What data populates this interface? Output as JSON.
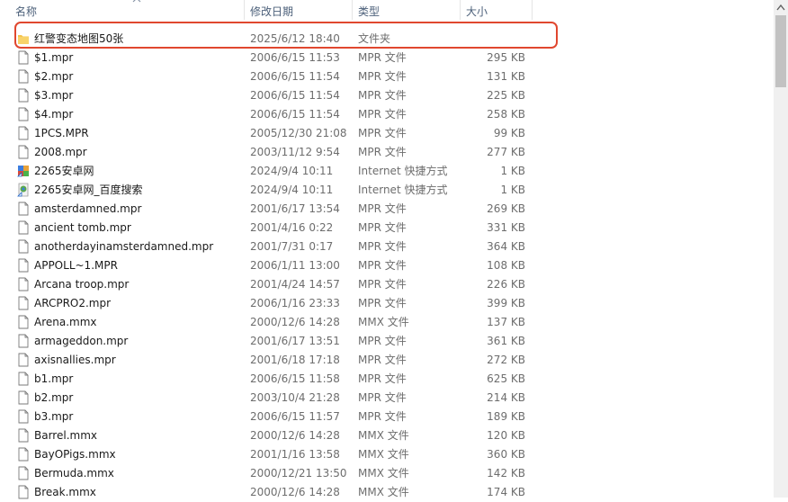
{
  "columns": {
    "name": "名称",
    "modified": "修改日期",
    "type": "类型",
    "size": "大小"
  },
  "rows": [
    {
      "icon": "folder",
      "name": "红警变态地图50张",
      "date": "2025/6/12 18:40",
      "type": "文件夹",
      "size": ""
    },
    {
      "icon": "file",
      "name": "$1.mpr",
      "date": "2006/6/15 11:53",
      "type": "MPR 文件",
      "size": "295 KB"
    },
    {
      "icon": "file",
      "name": "$2.mpr",
      "date": "2006/6/15 11:54",
      "type": "MPR 文件",
      "size": "131 KB"
    },
    {
      "icon": "file",
      "name": "$3.mpr",
      "date": "2006/6/15 11:54",
      "type": "MPR 文件",
      "size": "225 KB"
    },
    {
      "icon": "file",
      "name": "$4.mpr",
      "date": "2006/6/15 11:54",
      "type": "MPR 文件",
      "size": "258 KB"
    },
    {
      "icon": "file",
      "name": "1PCS.MPR",
      "date": "2005/12/30 21:08",
      "type": "MPR 文件",
      "size": "99 KB"
    },
    {
      "icon": "file",
      "name": "2008.mpr",
      "date": "2003/11/12 9:54",
      "type": "MPR 文件",
      "size": "277 KB"
    },
    {
      "icon": "internet-shortcut",
      "name": "2265安卓网",
      "date": "2024/9/4 10:11",
      "type": "Internet 快捷方式",
      "size": "1 KB"
    },
    {
      "icon": "internet-shortcut-2",
      "name": "2265安卓网_百度搜索",
      "date": "2024/9/4 10:11",
      "type": "Internet 快捷方式",
      "size": "1 KB"
    },
    {
      "icon": "file",
      "name": "amsterdamned.mpr",
      "date": "2001/6/17 13:54",
      "type": "MPR 文件",
      "size": "269 KB"
    },
    {
      "icon": "file",
      "name": "ancient tomb.mpr",
      "date": "2001/4/16 0:22",
      "type": "MPR 文件",
      "size": "331 KB"
    },
    {
      "icon": "file",
      "name": "anotherdayinamsterdamned.mpr",
      "date": "2001/7/31 0:17",
      "type": "MPR 文件",
      "size": "364 KB"
    },
    {
      "icon": "file",
      "name": "APPOLL~1.MPR",
      "date": "2006/1/11 13:00",
      "type": "MPR 文件",
      "size": "108 KB"
    },
    {
      "icon": "file",
      "name": "Arcana troop.mpr",
      "date": "2001/4/24 14:57",
      "type": "MPR 文件",
      "size": "226 KB"
    },
    {
      "icon": "file",
      "name": "ARCPRO2.mpr",
      "date": "2006/1/16 23:33",
      "type": "MPR 文件",
      "size": "399 KB"
    },
    {
      "icon": "file",
      "name": "Arena.mmx",
      "date": "2000/12/6 14:28",
      "type": "MMX 文件",
      "size": "137 KB"
    },
    {
      "icon": "file",
      "name": "armageddon.mpr",
      "date": "2001/6/17 13:51",
      "type": "MPR 文件",
      "size": "361 KB"
    },
    {
      "icon": "file",
      "name": "axisnallies.mpr",
      "date": "2001/6/18 17:18",
      "type": "MPR 文件",
      "size": "272 KB"
    },
    {
      "icon": "file",
      "name": "b1.mpr",
      "date": "2006/6/15 11:58",
      "type": "MPR 文件",
      "size": "625 KB"
    },
    {
      "icon": "file",
      "name": "b2.mpr",
      "date": "2003/10/4 21:28",
      "type": "MPR 文件",
      "size": "214 KB"
    },
    {
      "icon": "file",
      "name": "b3.mpr",
      "date": "2006/6/15 11:57",
      "type": "MPR 文件",
      "size": "189 KB"
    },
    {
      "icon": "file",
      "name": "Barrel.mmx",
      "date": "2000/12/6 14:28",
      "type": "MMX 文件",
      "size": "120 KB"
    },
    {
      "icon": "file",
      "name": "BayOPigs.mmx",
      "date": "2001/1/16 13:58",
      "type": "MMX 文件",
      "size": "360 KB"
    },
    {
      "icon": "file",
      "name": "Bermuda.mmx",
      "date": "2000/12/21 13:50",
      "type": "MMX 文件",
      "size": "142 KB"
    },
    {
      "icon": "file",
      "name": "Break.mmx",
      "date": "2000/12/6 14:28",
      "type": "MMX 文件",
      "size": "174 KB"
    }
  ],
  "colors": {
    "header_text": "#4c607a",
    "highlight_border": "#e0472f",
    "folder": "#f4c44c",
    "muted_text": "#6d6d6d"
  }
}
